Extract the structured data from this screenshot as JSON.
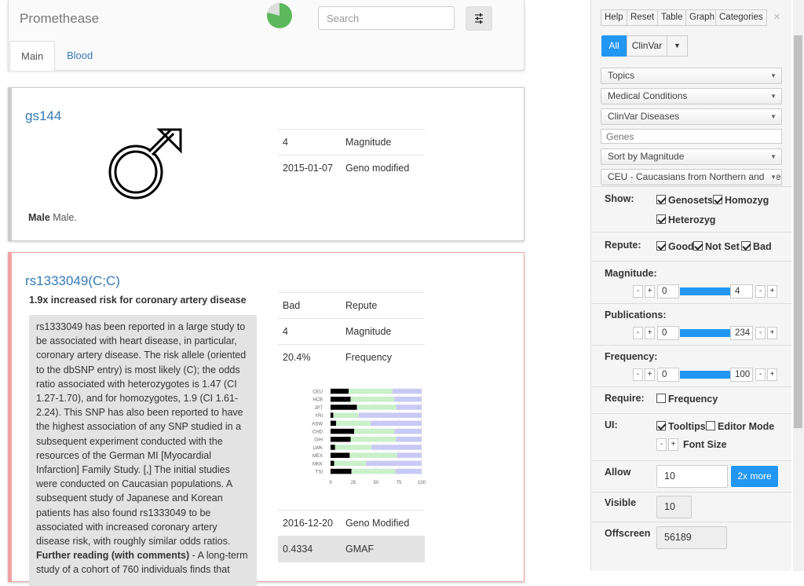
{
  "app": {
    "brand": "Promethease"
  },
  "search": {
    "placeholder": "Search"
  },
  "tabs": [
    {
      "label": "Main"
    },
    {
      "label": "Blood"
    }
  ],
  "card1": {
    "title": "gs144",
    "rows": [
      {
        "k": "4",
        "v": "Magnitude"
      },
      {
        "k": "2015-01-07",
        "v": "Geno modified"
      }
    ],
    "caption_bold": "Male",
    "caption": " Male.",
    "icon": "male-symbol-icon"
  },
  "card2": {
    "title": "rs1333049(C;C)",
    "summary": "1.9x increased risk for coronary artery disease",
    "description": "rs1333049 has been reported in a large study to be associated with heart disease, in particular, coronary artery disease. The risk allele (oriented to the dbSNP entry) is most likely (C); the odds ratio associated with heterozygotes is 1.47 (CI 1.27-1.70), and for homozygotes, 1.9 (CI 1.61-2.24). This SNP has also been reported to have the highest association of any SNP studied in a subsequent experiment conducted with the resources of the German MI [Myocardial Infarction] Family Study. [,] The initial studies were conducted on Caucasian populations. A subsequent study of Japanese and Korean patients has also found rs1333049 to be associated with increased coronary artery disease risk, with roughly similar odds ratios.",
    "further_bold": "Further reading (with comments)",
    "further": " - A long-term study of a cohort of 760 individuals finds that",
    "rows": [
      {
        "k": "Bad",
        "v": "Repute"
      },
      {
        "k": "4",
        "v": "Magnitude"
      },
      {
        "k": "20.4%",
        "v": "Frequency"
      }
    ],
    "bottom_rows": [
      {
        "k": "2016-12-20",
        "v": "Geno Modified"
      },
      {
        "k": "0.4334",
        "v": "GMAF"
      }
    ]
  },
  "chart_data": {
    "type": "bar",
    "stacked": true,
    "categories": [
      "CEU",
      "HCB",
      "JPT",
      "YRI",
      "ASW",
      "CHD",
      "GIH",
      "LWK",
      "MEX",
      "MKK",
      "TSI"
    ],
    "series": [
      {
        "values": [
          20,
          22,
          29,
          3,
          6,
          26,
          22,
          5,
          21,
          4,
          23
        ],
        "color": "#000000"
      },
      {
        "values": [
          48,
          48,
          43,
          28,
          38,
          44,
          50,
          40,
          52,
          35,
          48
        ],
        "color": "#c9f0c9"
      },
      {
        "values": [
          32,
          30,
          28,
          69,
          56,
          30,
          28,
          55,
          27,
          61,
          29
        ],
        "color": "#c9c9f5"
      }
    ],
    "xticks": [
      0,
      25,
      50,
      75,
      100
    ],
    "xlim": [
      0,
      100
    ]
  },
  "panel": {
    "top_buttons": [
      "Help",
      "Reset",
      "Table",
      "Graph",
      "Categories"
    ],
    "close": "×",
    "filter_all": "All",
    "filter_clinvar": "ClinVar",
    "selects": [
      "Topics",
      "Medical Conditions",
      "ClinVar Diseases"
    ],
    "genes_placeholder": "Genes",
    "sort": "Sort by Magnitude",
    "population": "CEU - Caucasians from Northern and Western Europe",
    "show_label": "Show:",
    "show": [
      "Genosets",
      "Homozyg",
      "Heterozyg"
    ],
    "repute_label": "Repute:",
    "repute": [
      "Good",
      "Not Set",
      "Bad"
    ],
    "magnitude_label": "Magnitude:",
    "magnitude": {
      "min": "0",
      "max": "4"
    },
    "publications_label": "Publications:",
    "publications": {
      "min": "0",
      "max": "234"
    },
    "frequency_label": "Frequency:",
    "frequency": {
      "min": "0",
      "max": "100"
    },
    "require_label": "Require:",
    "require": "Frequency",
    "ui_label": "UI:",
    "ui": [
      "Tooltips",
      "Editor Mode"
    ],
    "font_size": "Font Size",
    "allow_label": "Allow",
    "allow_value": "10",
    "more_button": "2x more",
    "visible_label": "Visible",
    "visible_value": "10",
    "offscreen_label": "Offscreen",
    "offscreen_value": "56189"
  }
}
